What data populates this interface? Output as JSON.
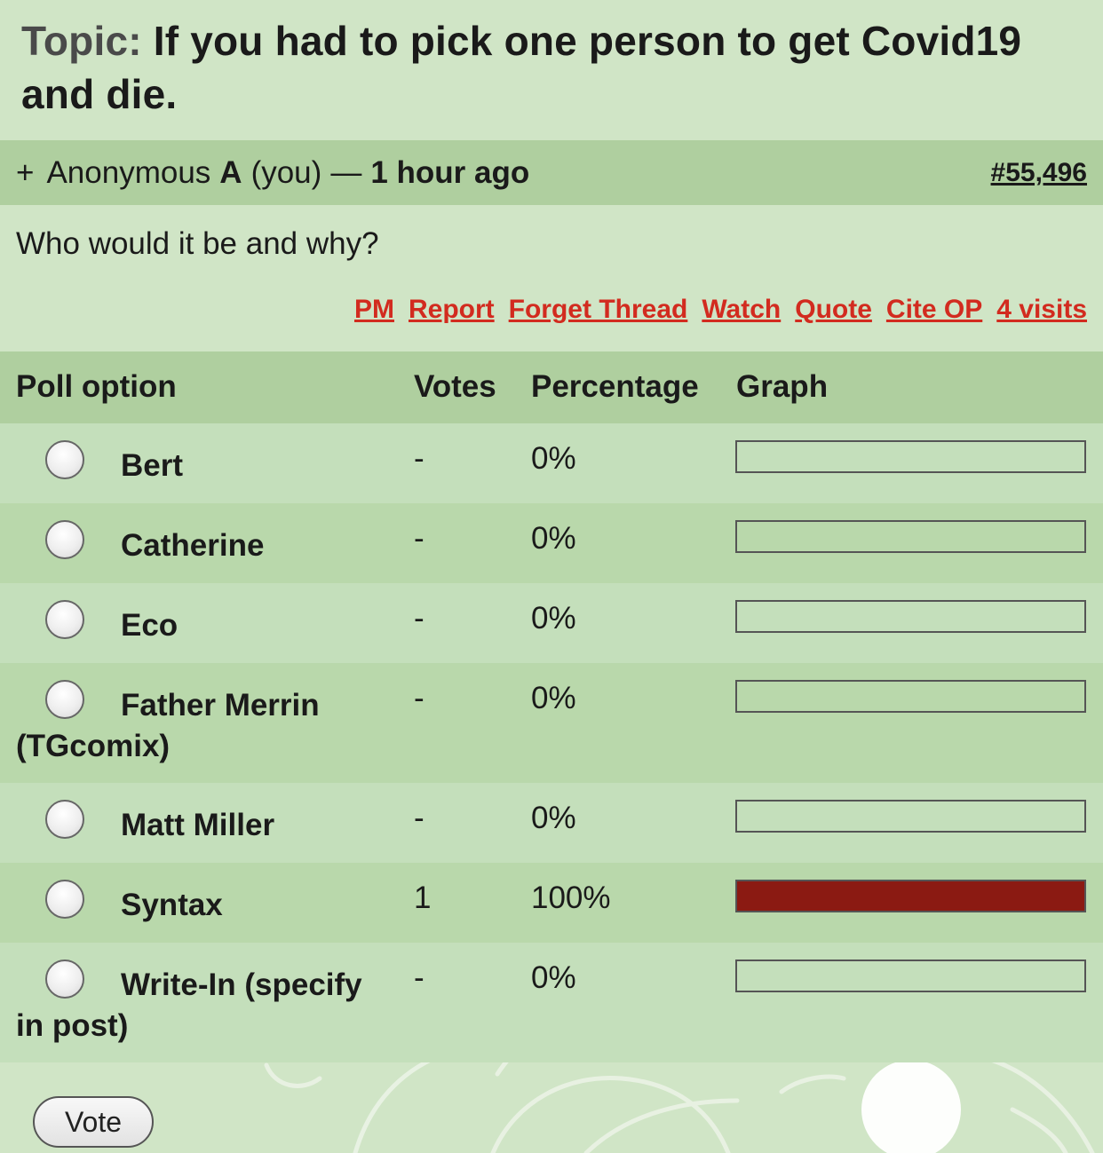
{
  "topic": {
    "label": "Topic:",
    "title": "If you had to pick one person to get Covid19 and die."
  },
  "reply": {
    "expand": "+",
    "author": "Anonymous",
    "author_letter": "A",
    "you": "(you)",
    "separator": "—",
    "time": "1 hour ago",
    "post_number": "#55,496",
    "body": "Who would it be and why?"
  },
  "actions": [
    "PM",
    "Report",
    "Forget Thread",
    "Watch",
    "Quote",
    "Cite OP",
    "4 visits"
  ],
  "poll": {
    "headers": {
      "option": "Poll option",
      "votes": "Votes",
      "percentage": "Percentage",
      "graph": "Graph"
    },
    "options": [
      {
        "label": "Bert",
        "votes": "-",
        "percentage": "0%",
        "fraction": 0
      },
      {
        "label": "Catherine",
        "votes": "-",
        "percentage": "0%",
        "fraction": 0
      },
      {
        "label": "Eco",
        "votes": "-",
        "percentage": "0%",
        "fraction": 0
      },
      {
        "label": "Father Merrin (TGcomix)",
        "votes": "-",
        "percentage": "0%",
        "fraction": 0
      },
      {
        "label": "Matt Miller",
        "votes": "-",
        "percentage": "0%",
        "fraction": 0
      },
      {
        "label": "Syntax",
        "votes": "1",
        "percentage": "100%",
        "fraction": 1
      },
      {
        "label": "Write-In (specify in post)",
        "votes": "-",
        "percentage": "0%",
        "fraction": 0
      }
    ],
    "bar_color": "#8b1a12",
    "vote_button": "Vote"
  }
}
